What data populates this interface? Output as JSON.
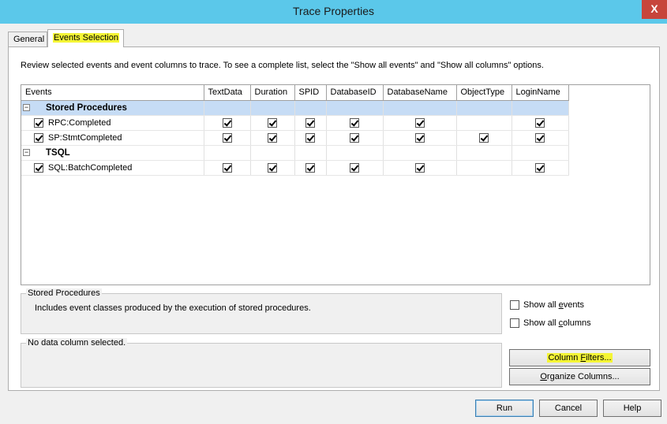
{
  "window": {
    "title": "Trace Properties",
    "close_glyph": "X"
  },
  "tabs": [
    {
      "label": "General",
      "active": false
    },
    {
      "label": "Events Selection",
      "active": true
    }
  ],
  "instructions": "Review selected events and event columns to trace. To see a complete list, select the \"Show all events\" and \"Show all columns\" options.",
  "grid": {
    "columns": [
      "Events",
      "TextData",
      "Duration",
      "SPID",
      "DatabaseID",
      "DatabaseName",
      "ObjectType",
      "LoginName"
    ],
    "groups": [
      {
        "name": "Stored Procedures",
        "expander": "−",
        "selected": true,
        "events": [
          {
            "name": "RPC:Completed",
            "checked": true,
            "cols": [
              true,
              true,
              true,
              true,
              true,
              false,
              true
            ]
          },
          {
            "name": "SP:StmtCompleted",
            "checked": true,
            "cols": [
              true,
              true,
              true,
              true,
              true,
              true,
              true
            ]
          }
        ]
      },
      {
        "name": "TSQL",
        "expander": "−",
        "selected": false,
        "events": [
          {
            "name": "SQL:BatchCompleted",
            "checked": true,
            "cols": [
              true,
              true,
              true,
              true,
              true,
              false,
              true
            ]
          }
        ]
      }
    ]
  },
  "event_description": {
    "title": "Stored Procedures",
    "text": "Includes event classes produced by the execution of stored procedures."
  },
  "column_description": {
    "title": "No data column selected."
  },
  "options": {
    "show_all_events": {
      "label": "Show all events",
      "checked": false
    },
    "show_all_columns": {
      "label": "Show all columns",
      "checked": false
    }
  },
  "buttons": {
    "column_filters": "Column Filters...",
    "organize_columns": "Organize Columns...",
    "run": "Run",
    "cancel": "Cancel",
    "help": "Help"
  },
  "highlight_color": "#f4f535",
  "titlebar_color": "#5bc8ea"
}
